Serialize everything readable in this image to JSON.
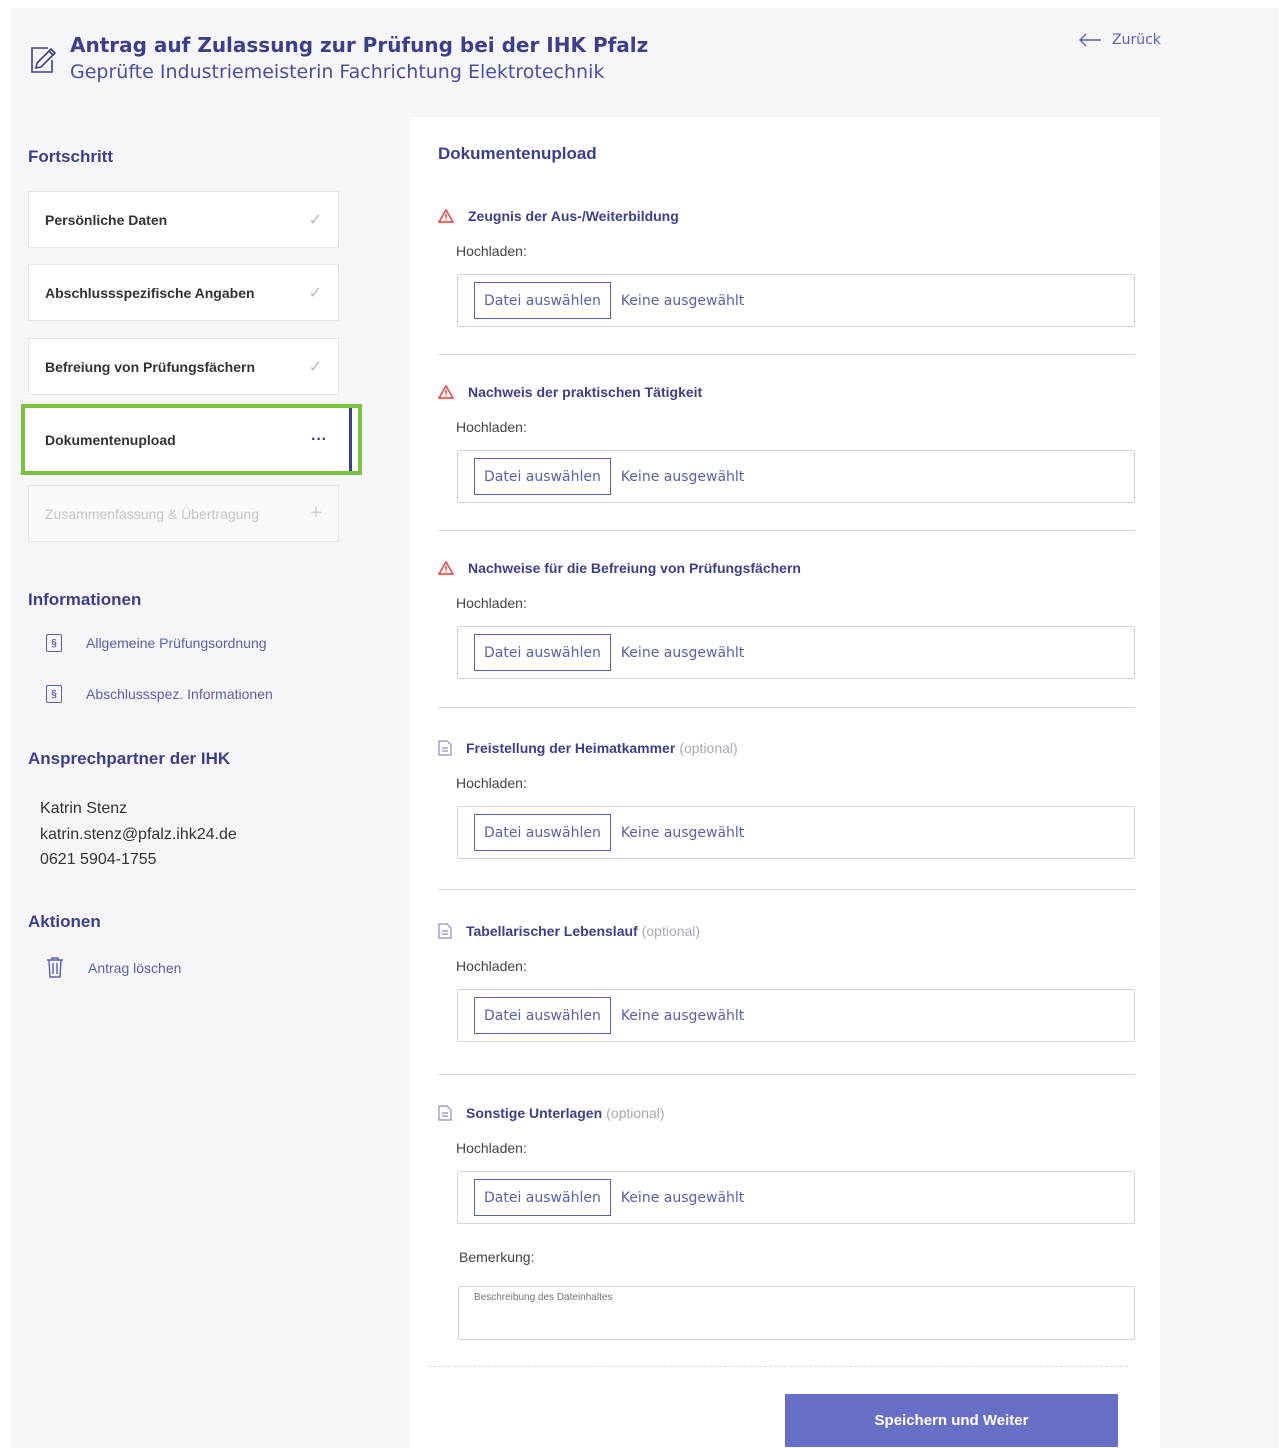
{
  "header": {
    "title": "Antrag auf Zulassung zur Prüfung bei der IHK Pfalz",
    "subtitle": "Geprüfte Industriemeisterin Fachrichtung Elektrotechnik",
    "back_label": "Zurück",
    "icon": "edit-form-icon"
  },
  "sidebar": {
    "progress_heading": "Fortschritt",
    "steps": [
      {
        "label": "Persönliche Daten",
        "state": "done",
        "icon": "✓"
      },
      {
        "label": "Abschlussspezifische Angaben",
        "state": "done",
        "icon": "✓"
      },
      {
        "label": "Befreiung von Prüfungsfächern",
        "state": "done",
        "icon": "✓"
      },
      {
        "label": "Dokumentenupload",
        "state": "active",
        "icon": "···"
      },
      {
        "label": "Zusammenfassung & Übertragung",
        "state": "disabled",
        "icon": "+"
      }
    ],
    "info_heading": "Informationen",
    "info_links": [
      {
        "label": "Allgemeine Prüfungsordnung",
        "icon": "§"
      },
      {
        "label": "Abschlussspez. Informationen",
        "icon": "§"
      }
    ],
    "contact_heading": "Ansprechpartner der IHK",
    "contact": {
      "name": "Katrin Stenz",
      "email": "katrin.stenz@pfalz.ihk24.de",
      "phone": "0621 5904-1755"
    },
    "actions_heading": "Aktionen",
    "delete_label": "Antrag löschen"
  },
  "main": {
    "title": "Dokumentenupload",
    "upload_label": "Hochladen:",
    "file_button_label": "Datei auswählen",
    "file_none_label": "Keine ausgewählt",
    "optional_label": "(optional)",
    "documents": [
      {
        "title": "Zeugnis der Aus-/Weiterbildung",
        "required": true
      },
      {
        "title": "Nachweis der praktischen Tätigkeit",
        "required": true
      },
      {
        "title": "Nachweise für die Befreiung von Prüfungsfächern",
        "required": true
      },
      {
        "title": "Freistellung der Heimatkammer",
        "required": false
      },
      {
        "title": "Tabellarischer Lebenslauf",
        "required": false
      },
      {
        "title": "Sonstige Unterlagen",
        "required": false
      }
    ],
    "remark_label": "Bemerkung:",
    "remark_placeholder": "Beschreibung des Dateinhaltes",
    "save_label": "Speichern und Weiter"
  },
  "colors": {
    "primary": "#3d3f88",
    "accent_button": "#6770c6",
    "active_border": "#7cc242",
    "warning": "#e53935"
  }
}
